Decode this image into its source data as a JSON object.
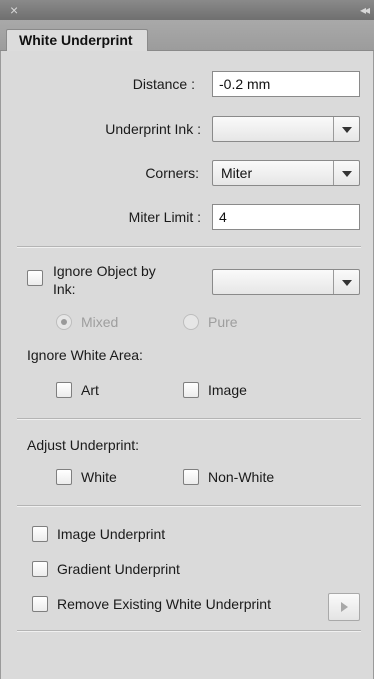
{
  "window": {
    "close_glyph": "×",
    "collapse_glyph": "◂◂"
  },
  "tab": {
    "label": "White Underprint"
  },
  "fields": {
    "distance": {
      "label": "Distance :",
      "value": "-0.2 mm"
    },
    "underprint_ink": {
      "label": "Underprint Ink :",
      "value": ""
    },
    "corners": {
      "label": "Corners:",
      "value": "Miter"
    },
    "miter_limit": {
      "label": "Miter Limit :",
      "value": "4"
    }
  },
  "ignore_object": {
    "label_line1": "Ignore Object by",
    "label_line2": "Ink:",
    "checked": false,
    "ink_value": "",
    "mixed_label": "Mixed",
    "pure_label": "Pure",
    "selected": "Mixed"
  },
  "ignore_white_area": {
    "label": "Ignore White Area:",
    "art_label": "Art",
    "image_label": "Image"
  },
  "adjust_underprint": {
    "label": "Adjust Underprint:",
    "white_label": "White",
    "non_white_label": "Non-White"
  },
  "options": {
    "image_underprint": "Image Underprint",
    "gradient_underprint": "Gradient Underprint",
    "remove_existing": "Remove Existing White Underprint"
  },
  "icons": {
    "close": "close-icon",
    "collapse": "collapse-icon",
    "dropdown": "chevron-down-icon",
    "apply": "play-icon"
  },
  "colors": {
    "panel_bg": "#dadada",
    "titlebar": "#7a7a7a",
    "disabled_text": "#9e9e9e"
  }
}
